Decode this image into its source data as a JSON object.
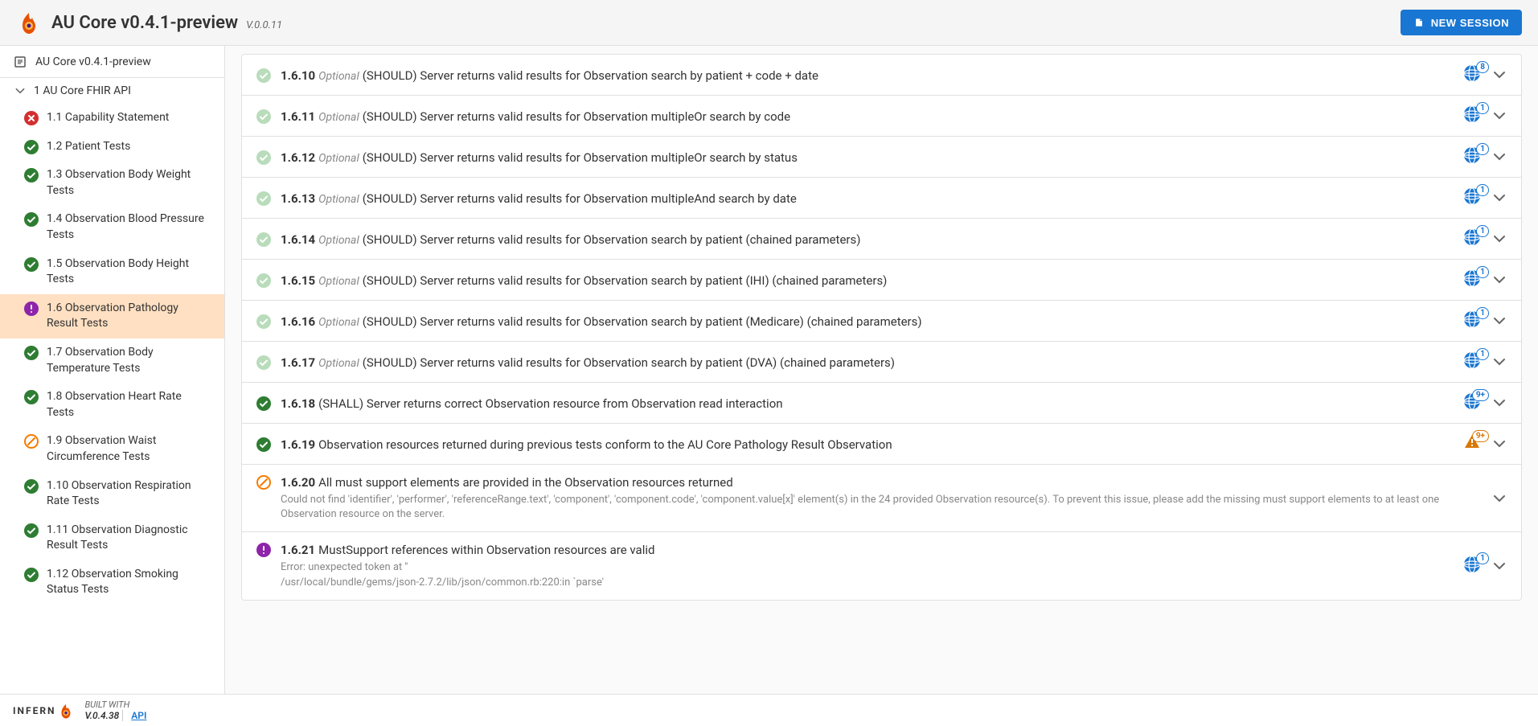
{
  "header": {
    "title": "AU Core v0.4.1-preview",
    "version": "V.0.0.11",
    "new_session": "NEW SESSION"
  },
  "sidebar": {
    "root": "AU Core v0.4.1-preview",
    "group": "1 AU Core FHIR API",
    "items": [
      {
        "status": "fail",
        "label": "1.1 Capability Statement"
      },
      {
        "status": "pass",
        "label": "1.2 Patient Tests"
      },
      {
        "status": "pass",
        "label": "1.3 Observation Body Weight Tests"
      },
      {
        "status": "pass",
        "label": "1.4 Observation Blood Pressure Tests"
      },
      {
        "status": "pass",
        "label": "1.5 Observation Body Height Tests"
      },
      {
        "status": "error",
        "label": "1.6 Observation Pathology Result Tests",
        "selected": true
      },
      {
        "status": "pass",
        "label": "1.7 Observation Body Temperature Tests"
      },
      {
        "status": "pass",
        "label": "1.8 Observation Heart Rate Tests"
      },
      {
        "status": "skip",
        "label": "1.9 Observation Waist Circumference Tests"
      },
      {
        "status": "pass",
        "label": "1.10 Observation Respiration Rate Tests"
      },
      {
        "status": "pass",
        "label": "1.11 Observation Diagnostic Result Tests"
      },
      {
        "status": "pass",
        "label": "1.12 Observation Smoking Status Tests"
      }
    ]
  },
  "tests": [
    {
      "status": "pass-weak",
      "id": "1.6.10",
      "tag": "Optional",
      "desc": "(SHOULD) Server returns valid results for Observation search by patient + code + date",
      "count": "8",
      "countType": "globe"
    },
    {
      "status": "pass-weak",
      "id": "1.6.11",
      "tag": "Optional",
      "desc": "(SHOULD) Server returns valid results for Observation multipleOr search by code",
      "count": "1",
      "countType": "globe"
    },
    {
      "status": "pass-weak",
      "id": "1.6.12",
      "tag": "Optional",
      "desc": "(SHOULD) Server returns valid results for Observation multipleOr search by status",
      "count": "1",
      "countType": "globe"
    },
    {
      "status": "pass-weak",
      "id": "1.6.13",
      "tag": "Optional",
      "desc": "(SHOULD) Server returns valid results for Observation multipleAnd search by date",
      "count": "1",
      "countType": "globe"
    },
    {
      "status": "pass-weak",
      "id": "1.6.14",
      "tag": "Optional",
      "desc": "(SHOULD) Server returns valid results for Observation search by patient (chained parameters)",
      "count": "1",
      "countType": "globe"
    },
    {
      "status": "pass-weak",
      "id": "1.6.15",
      "tag": "Optional",
      "desc": "(SHOULD) Server returns valid results for Observation search by patient (IHI) (chained parameters)",
      "count": "1",
      "countType": "globe"
    },
    {
      "status": "pass-weak",
      "id": "1.6.16",
      "tag": "Optional",
      "desc": "(SHOULD) Server returns valid results for Observation search by patient (Medicare) (chained parameters)",
      "count": "1",
      "countType": "globe"
    },
    {
      "status": "pass-weak",
      "id": "1.6.17",
      "tag": "Optional",
      "desc": "(SHOULD) Server returns valid results for Observation search by patient (DVA) (chained parameters)",
      "count": "1",
      "countType": "globe"
    },
    {
      "status": "pass",
      "id": "1.6.18",
      "tag": "",
      "desc": "(SHALL) Server returns correct Observation resource from Observation read interaction",
      "count": "9+",
      "countType": "globe"
    },
    {
      "status": "pass",
      "id": "1.6.19",
      "tag": "",
      "desc": "Observation resources returned during previous tests conform to the AU Core Pathology Result Observation",
      "count": "9+",
      "countType": "warn"
    },
    {
      "status": "skip",
      "id": "1.6.20",
      "tag": "",
      "desc": "All must support elements are provided in the Observation resources returned",
      "sub": "Could not find 'identifier', 'performer', 'referenceRange.text', 'component', 'component.code', 'component.value[x]' element(s) in the 24 provided Observation resource(s). To prevent this issue, please add the missing must support elements to at least one Observation resource on the server.",
      "count": "",
      "countType": ""
    },
    {
      "status": "error",
      "id": "1.6.21",
      "tag": "",
      "desc": "MustSupport references within Observation resources are valid",
      "sub": "Error: unexpected token at ''\n/usr/local/bundle/gems/json-2.7.2/lib/json/common.rb:220:in `parse'",
      "count": "1",
      "countType": "globe"
    }
  ],
  "footer": {
    "brand": "INFERN",
    "built": "BUILT WITH",
    "version": "V.0.4.38",
    "api": "API"
  }
}
